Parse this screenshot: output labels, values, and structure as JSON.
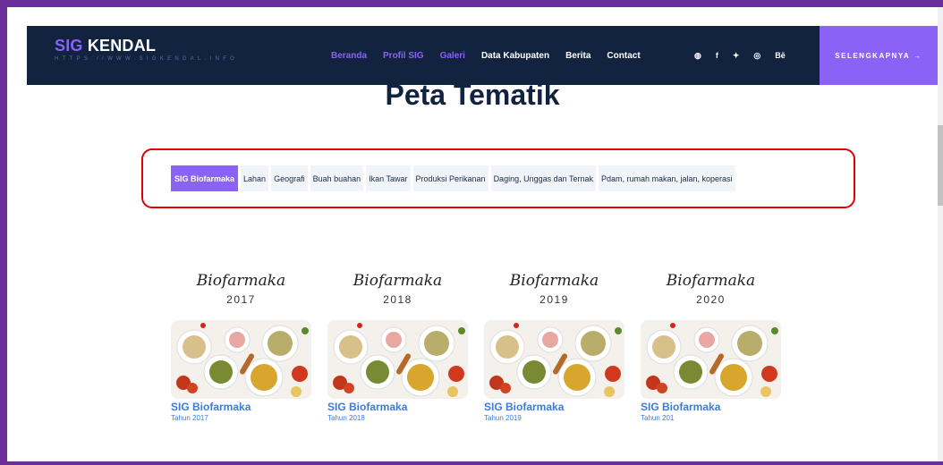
{
  "brand": {
    "name_part1": "SIG",
    "name_part2": "KENDAL",
    "url": "HTTPS://WWW.SIGKENDAL.INFO"
  },
  "nav": [
    {
      "label": "Beranda",
      "name": "nav-beranda"
    },
    {
      "label": "Profil SIG",
      "name": "nav-profil-sig"
    },
    {
      "label": "Galeri",
      "name": "nav-galeri"
    },
    {
      "label": "Data Kabupaten",
      "name": "nav-data-kabupaten"
    },
    {
      "label": "Berita",
      "name": "nav-berita"
    },
    {
      "label": "Contact",
      "name": "nav-contact"
    }
  ],
  "social": {
    "dribbble": "◍",
    "facebook": "f",
    "twitter": "✦",
    "instagram": "◎",
    "behance": "Bē"
  },
  "cta": {
    "label": "SELENGKAPNYA",
    "arrow": "→"
  },
  "page_title": "Peta Tematik",
  "filters": [
    {
      "label": "SIG Biofarmaka",
      "active": true
    },
    {
      "label": "Lahan"
    },
    {
      "label": "Geografi"
    },
    {
      "label": "Buah buahan"
    },
    {
      "label": "Ikan Tawar"
    },
    {
      "label": "Produksi Perikanan"
    },
    {
      "label": "Daging, Unggas dan Ternak"
    },
    {
      "label": "Pdam, rumah makan, jalan, koperasi"
    }
  ],
  "cards": [
    {
      "cover_title": "Biofarmaka",
      "cover_year": "2017",
      "title": "SIG Biofarmaka",
      "subtitle": "Tahun 2017"
    },
    {
      "cover_title": "Biofarmaka",
      "cover_year": "2018",
      "title": "SIG Biofarmaka",
      "subtitle": "Tahun 2018"
    },
    {
      "cover_title": "Biofarmaka",
      "cover_year": "2019",
      "title": "SIG Biofarmaka",
      "subtitle": "Tahun 2019"
    },
    {
      "cover_title": "Biofarmaka",
      "cover_year": "2020",
      "title": "SIG Biofarmaka",
      "subtitle": "Tahun 201"
    }
  ],
  "colors": {
    "navy": "#122340",
    "accent": "#8a63f6",
    "highlight_red": "#e00000",
    "link_blue": "#3a7bdc"
  }
}
